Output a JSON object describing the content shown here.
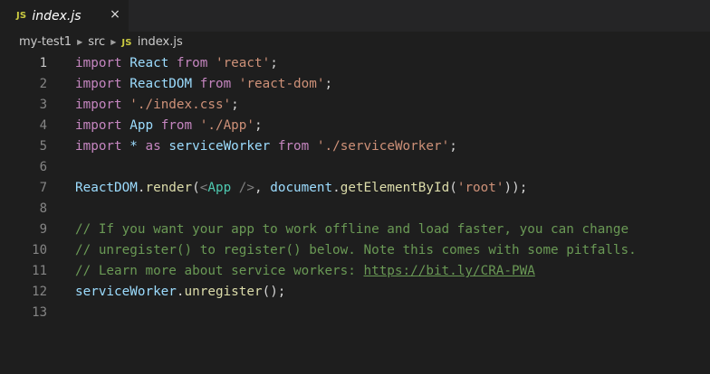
{
  "tab": {
    "badge": "JS",
    "title": "index.js",
    "close": "×"
  },
  "breadcrumb": {
    "items": [
      "my-test1",
      "src"
    ],
    "file_badge": "JS",
    "file": "index.js"
  },
  "editor": {
    "active_line": 1,
    "line_numbers": [
      "1",
      "2",
      "3",
      "4",
      "5",
      "6",
      "7",
      "8",
      "9",
      "10",
      "11",
      "12",
      "13"
    ],
    "lines": [
      [
        {
          "t": "import",
          "c": "kw"
        },
        {
          "t": " "
        },
        {
          "t": "React",
          "c": "id"
        },
        {
          "t": " "
        },
        {
          "t": "from",
          "c": "kw"
        },
        {
          "t": " "
        },
        {
          "t": "'react'",
          "c": "str"
        },
        {
          "t": ";",
          "c": "p"
        }
      ],
      [
        {
          "t": "import",
          "c": "kw"
        },
        {
          "t": " "
        },
        {
          "t": "ReactDOM",
          "c": "id"
        },
        {
          "t": " "
        },
        {
          "t": "from",
          "c": "kw"
        },
        {
          "t": " "
        },
        {
          "t": "'react-dom'",
          "c": "str"
        },
        {
          "t": ";",
          "c": "p"
        }
      ],
      [
        {
          "t": "import",
          "c": "kw"
        },
        {
          "t": " "
        },
        {
          "t": "'./index.css'",
          "c": "str"
        },
        {
          "t": ";",
          "c": "p"
        }
      ],
      [
        {
          "t": "import",
          "c": "kw"
        },
        {
          "t": " "
        },
        {
          "t": "App",
          "c": "id"
        },
        {
          "t": " "
        },
        {
          "t": "from",
          "c": "kw"
        },
        {
          "t": " "
        },
        {
          "t": "'./App'",
          "c": "str"
        },
        {
          "t": ";",
          "c": "p"
        }
      ],
      [
        {
          "t": "import",
          "c": "kw"
        },
        {
          "t": " "
        },
        {
          "t": "*",
          "c": "id"
        },
        {
          "t": " "
        },
        {
          "t": "as",
          "c": "kw"
        },
        {
          "t": " "
        },
        {
          "t": "serviceWorker",
          "c": "id"
        },
        {
          "t": " "
        },
        {
          "t": "from",
          "c": "kw"
        },
        {
          "t": " "
        },
        {
          "t": "'./serviceWorker'",
          "c": "str"
        },
        {
          "t": ";",
          "c": "p"
        }
      ],
      [],
      [
        {
          "t": "ReactDOM",
          "c": "id"
        },
        {
          "t": ".",
          "c": "p"
        },
        {
          "t": "render",
          "c": "fn"
        },
        {
          "t": "(",
          "c": "p"
        },
        {
          "t": "<",
          "c": "angle"
        },
        {
          "t": "App",
          "c": "tag"
        },
        {
          "t": " />",
          "c": "angle"
        },
        {
          "t": ", ",
          "c": "p"
        },
        {
          "t": "document",
          "c": "id"
        },
        {
          "t": ".",
          "c": "p"
        },
        {
          "t": "getElementById",
          "c": "fn"
        },
        {
          "t": "(",
          "c": "p"
        },
        {
          "t": "'root'",
          "c": "str"
        },
        {
          "t": "));",
          "c": "p"
        }
      ],
      [],
      [
        {
          "t": "// If you want your app to work offline and load faster, you can change",
          "c": "cm"
        }
      ],
      [
        {
          "t": "// unregister() to register() below. Note this comes with some pitfalls.",
          "c": "cm"
        }
      ],
      [
        {
          "t": "// Learn more about service workers: ",
          "c": "cm"
        },
        {
          "t": "https://bit.ly/CRA-PWA",
          "c": "link"
        }
      ],
      [
        {
          "t": "serviceWorker",
          "c": "id"
        },
        {
          "t": ".",
          "c": "p"
        },
        {
          "t": "unregister",
          "c": "fn"
        },
        {
          "t": "();",
          "c": "p"
        }
      ],
      []
    ]
  },
  "colors": {
    "editor_bg": "#1e1e1e",
    "tabbar_bg": "#252526",
    "keyword": "#c586c0",
    "string": "#ce9178",
    "identifier": "#9cdcfe",
    "function": "#dcdcaa",
    "comment": "#6a9955",
    "js_badge": "#cbcb41"
  }
}
